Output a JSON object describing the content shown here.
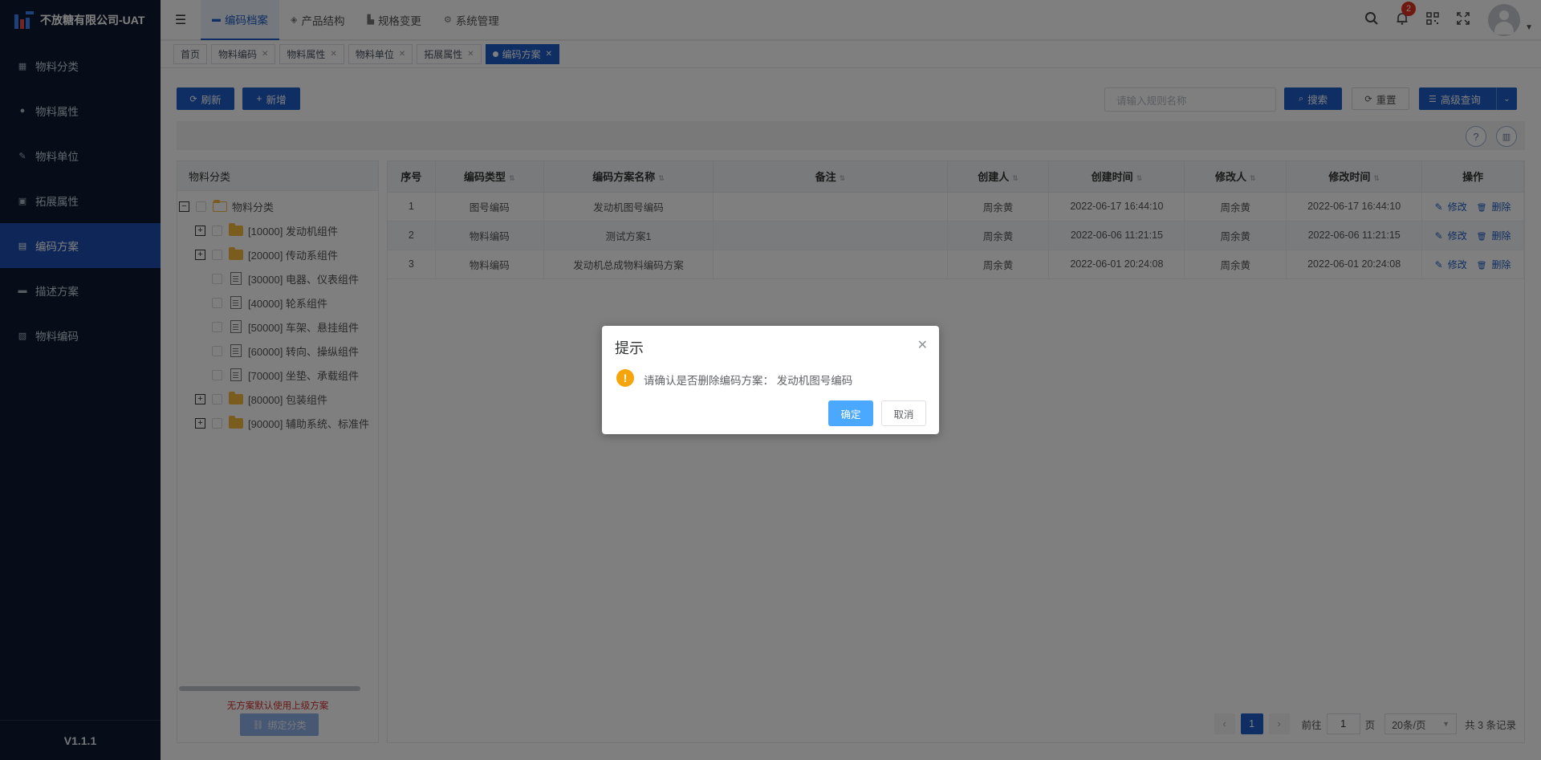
{
  "app": {
    "title": "不放糖有限公司-UAT",
    "version": "V1.1.1"
  },
  "sidebar": {
    "items": [
      {
        "label": "物料分类",
        "icon": "grid-icon"
      },
      {
        "label": "物料属性",
        "icon": "info-icon"
      },
      {
        "label": "物料单位",
        "icon": "wrench-icon"
      },
      {
        "label": "拓展属性",
        "icon": "image-icon"
      },
      {
        "label": "编码方案",
        "icon": "book-icon",
        "active": true
      },
      {
        "label": "描述方案",
        "icon": "monitor-icon"
      },
      {
        "label": "物料编码",
        "icon": "document-icon"
      }
    ]
  },
  "header": {
    "tabs": [
      {
        "label": "编码档案",
        "icon": "folder-icon",
        "active": true
      },
      {
        "label": "产品结构",
        "icon": "layers-icon"
      },
      {
        "label": "规格变更",
        "icon": "chart-icon"
      },
      {
        "label": "系统管理",
        "icon": "gear-icon"
      }
    ],
    "notification_count": "2"
  },
  "tags": [
    {
      "label": "首页",
      "closable": false
    },
    {
      "label": "物料编码",
      "closable": true
    },
    {
      "label": "物料属性",
      "closable": true
    },
    {
      "label": "物料单位",
      "closable": true
    },
    {
      "label": "拓展属性",
      "closable": true
    },
    {
      "label": "编码方案",
      "closable": true,
      "active": true
    }
  ],
  "toolbar": {
    "refresh_label": "刷新",
    "add_label": "新增",
    "search_placeholder": "请输入规则名称",
    "search_label": "搜索",
    "reset_label": "重置",
    "advanced_label": "高级查询"
  },
  "tree": {
    "header": "物料分类",
    "root": "物料分类",
    "nodes": [
      {
        "label": "[10000] 发动机组件",
        "type": "folder",
        "expandable": true
      },
      {
        "label": "[20000] 传动系组件",
        "type": "folder",
        "expandable": true
      },
      {
        "label": "[30000] 电器、仪表组件",
        "type": "doc",
        "expandable": false
      },
      {
        "label": "[40000] 轮系组件",
        "type": "doc",
        "expandable": false
      },
      {
        "label": "[50000] 车架、悬挂组件",
        "type": "doc",
        "expandable": false
      },
      {
        "label": "[60000] 转向、操纵组件",
        "type": "doc",
        "expandable": false
      },
      {
        "label": "[70000] 坐垫、承载组件",
        "type": "doc",
        "expandable": false
      },
      {
        "label": "[80000] 包装组件",
        "type": "folder",
        "expandable": true
      },
      {
        "label": "[90000] 辅助系统、标准件",
        "type": "folder",
        "expandable": true
      }
    ],
    "note": "无方案默认使用上级方案",
    "bind_label": "绑定分类"
  },
  "table": {
    "columns": [
      "序号",
      "编码类型",
      "编码方案名称",
      "备注",
      "创建人",
      "创建时间",
      "修改人",
      "修改时间",
      "操作"
    ],
    "rows": [
      {
        "no": "1",
        "type": "图号编码",
        "name": "发动机图号编码",
        "remark": "",
        "creator": "周余黄",
        "created": "2022-06-17 16:44:10",
        "modifier": "周余黄",
        "modified": "2022-06-17 16:44:10"
      },
      {
        "no": "2",
        "type": "物料编码",
        "name": "测试方案1",
        "remark": "",
        "creator": "周余黄",
        "created": "2022-06-06 11:21:15",
        "modifier": "周余黄",
        "modified": "2022-06-06 11:21:15"
      },
      {
        "no": "3",
        "type": "物料编码",
        "name": "发动机总成物料编码方案",
        "remark": "",
        "creator": "周余黄",
        "created": "2022-06-01 20:24:08",
        "modifier": "周余黄",
        "modified": "2022-06-01 20:24:08"
      }
    ],
    "edit_label": "修改",
    "delete_label": "删除"
  },
  "pagination": {
    "current": "1",
    "goto_prefix": "前往",
    "goto_value": "1",
    "goto_suffix": "页",
    "page_size": "20条/页",
    "total": "共 3 条记录"
  },
  "dialog": {
    "title": "提示",
    "message": "请确认是否删除编码方案：  发动机图号编码",
    "ok_label": "确定",
    "cancel_label": "取消"
  }
}
